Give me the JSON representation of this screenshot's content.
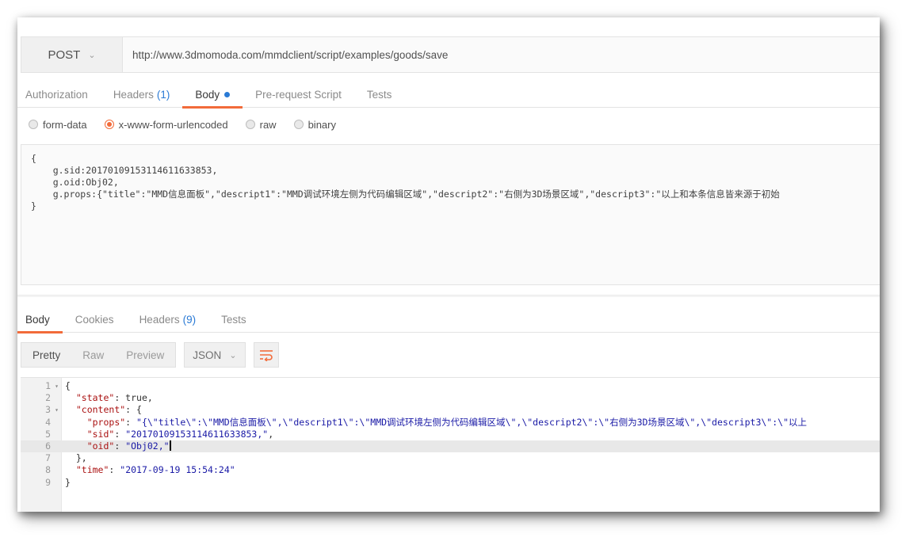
{
  "request": {
    "method": "POST",
    "url": "http://www.3dmomoda.com/mmdclient/script/examples/goods/save"
  },
  "request_tabs": [
    {
      "label": "Authorization",
      "count": ""
    },
    {
      "label": "Headers",
      "count": "(1)"
    },
    {
      "label": "Body",
      "count": ""
    },
    {
      "label": "Pre-request Script",
      "count": ""
    },
    {
      "label": "Tests",
      "count": ""
    }
  ],
  "body_modes": [
    "form-data",
    "x-www-form-urlencoded",
    "raw",
    "binary"
  ],
  "body_mode_selected": "x-www-form-urlencoded",
  "raw_body": [
    "{",
    "    g.sid:20170109153114611633853,",
    "    g.oid:Obj02,",
    "    g.props:{\"title\":\"MMD信息面板\",\"descript1\":\"MMD调试环境左侧为代码编辑区域\",\"descript2\":\"右侧为3D场景区域\",\"descript3\":\"以上和本条信息皆来源于初始",
    "}"
  ],
  "response_tabs": [
    {
      "label": "Body",
      "count": ""
    },
    {
      "label": "Cookies",
      "count": ""
    },
    {
      "label": "Headers",
      "count": "(9)"
    },
    {
      "label": "Tests",
      "count": ""
    }
  ],
  "view_modes": [
    "Pretty",
    "Raw",
    "Preview"
  ],
  "view_mode_selected": "Pretty",
  "format": "JSON",
  "response_lines": [
    {
      "n": "1",
      "fold": "▾",
      "text": "{"
    },
    {
      "n": "2",
      "fold": "",
      "key": "\"state\"",
      "rest": ": true,"
    },
    {
      "n": "3",
      "fold": "▾",
      "key": "\"content\"",
      "rest": ": {"
    },
    {
      "n": "4",
      "fold": "",
      "indent": "    ",
      "key": "\"props\"",
      "sep": ": ",
      "str": "\"{\\\"title\\\":\\\"MMD信息面板\\\",\\\"descript1\\\":\\\"MMD调试环境左侧为代码编辑区域\\\",\\\"descript2\\\":\\\"右侧为3D场景区域\\\",\\\"descript3\\\":\\\"以上"
    },
    {
      "n": "5",
      "fold": "",
      "indent": "    ",
      "key": "\"sid\"",
      "sep": ": ",
      "str": "\"20170109153114611633853,\"",
      "tail": ","
    },
    {
      "n": "6",
      "fold": "",
      "indent": "    ",
      "key": "\"oid\"",
      "sep": ": ",
      "str": "\"Obj02,\""
    },
    {
      "n": "7",
      "fold": "",
      "text": "  },"
    },
    {
      "n": "8",
      "fold": "",
      "key": "\"time\"",
      "sep": ": ",
      "str": "\"2017-09-19 15:54:24\""
    },
    {
      "n": "9",
      "fold": "",
      "text": "}"
    }
  ],
  "colors": {
    "accent": "#f26b3a",
    "link_blue": "#2a7ad5",
    "json_key": "#aa1111",
    "json_string": "#1a1aa6"
  },
  "icons": {
    "method_dropdown": "chevron-down-icon",
    "format_dropdown": "chevron-down-icon",
    "wrap": "wrap-lines-icon"
  }
}
